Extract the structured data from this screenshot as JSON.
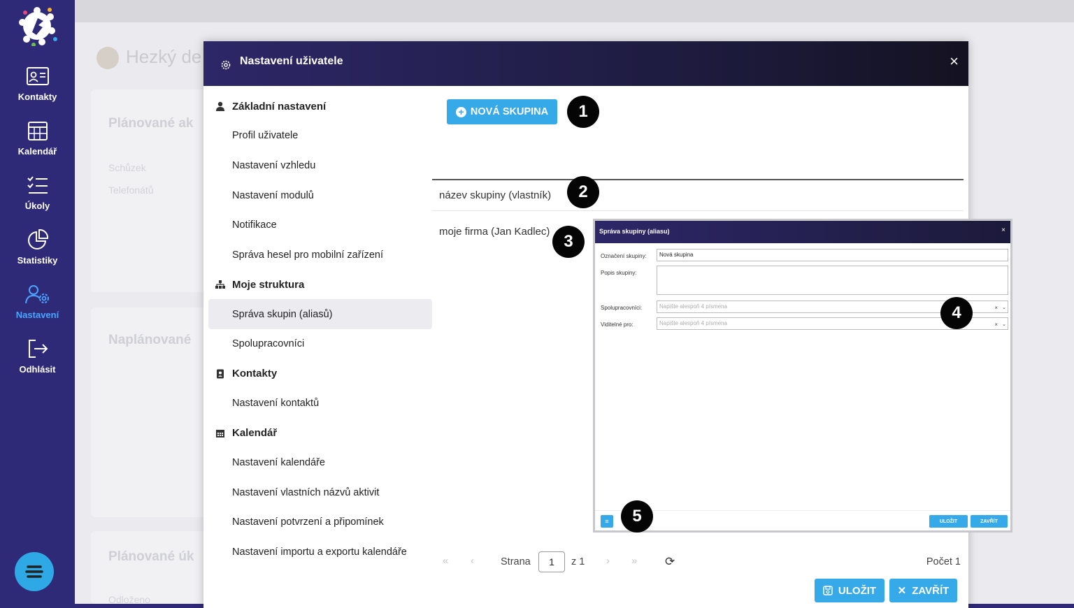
{
  "sidebar": {
    "items": [
      {
        "label": "Kontakty",
        "icon": "contacts-icon"
      },
      {
        "label": "Kalendář",
        "icon": "calendar-icon"
      },
      {
        "label": "Úkoly",
        "icon": "tasks-icon"
      },
      {
        "label": "Statistiky",
        "icon": "stats-icon"
      },
      {
        "label": "Nastavení",
        "icon": "settings-icon",
        "active": true
      },
      {
        "label": "Odhlásit",
        "icon": "logout-icon"
      }
    ],
    "accent": "#2e2a78",
    "active_color": "#4aa6ff"
  },
  "background": {
    "greeting": "Hezký de",
    "card1_title": "Plánované ak",
    "card1_items": [
      "Schůzek",
      "Telefonátů"
    ],
    "card2_title": "Naplánované",
    "card3_title": "Plánované úk",
    "card3_item": "Odloženo"
  },
  "modal": {
    "title": "Nastavení uživatele",
    "close": "×",
    "nav": {
      "basic": {
        "title": "Základní nastavení",
        "items": [
          "Profil uživatele",
          "Nastavení vzhledu",
          "Nastavení modulů",
          "Notifikace",
          "Správa hesel pro mobilní zařízení"
        ]
      },
      "structure": {
        "title": "Moje struktura",
        "items": [
          "Správa skupin (aliasů)",
          "Spolupracovníci"
        ]
      },
      "contacts": {
        "title": "Kontakty",
        "items": [
          "Nastavení kontaktů"
        ]
      },
      "calendar": {
        "title": "Kalendář",
        "items": [
          "Nastavení kalendáře",
          "Nastavení vlastních názvů aktivit",
          "Nastavení potvrzení a připomínek",
          "Nastavení importu a exportu kalendáře"
        ]
      }
    },
    "new_group_button": "NOVÁ SKUPINA",
    "table": {
      "column_header": "název skupiny (vlastník)",
      "rows": [
        "moje firma (Jan Kadlec)"
      ]
    },
    "pager": {
      "page_label": "Strana",
      "page_value": "1",
      "of_label": "z 1",
      "count_label": "Počet 1"
    },
    "footer": {
      "save": "ULOŽIT",
      "close": "ZAVŘÍT"
    },
    "accent": "#36a9e8"
  },
  "subdialog": {
    "title": "Správa skupiny (aliasu)",
    "close": "×",
    "fields": {
      "name_label": "Označení skupiny:",
      "name_value": "Nová skupina",
      "description_label": "Popis skupiny:",
      "collaborators_label": "Spolupracovníci:",
      "collaborators_placeholder": "Napište alespoň 4 písmena",
      "visible_label": "Viditelné pro:",
      "visible_placeholder": "Napište alespoň 4 písmena"
    },
    "footer": {
      "save": "ULOŽIT",
      "close": "ZAVŘÍT"
    }
  },
  "callouts": [
    "1",
    "2",
    "3",
    "4",
    "5"
  ]
}
